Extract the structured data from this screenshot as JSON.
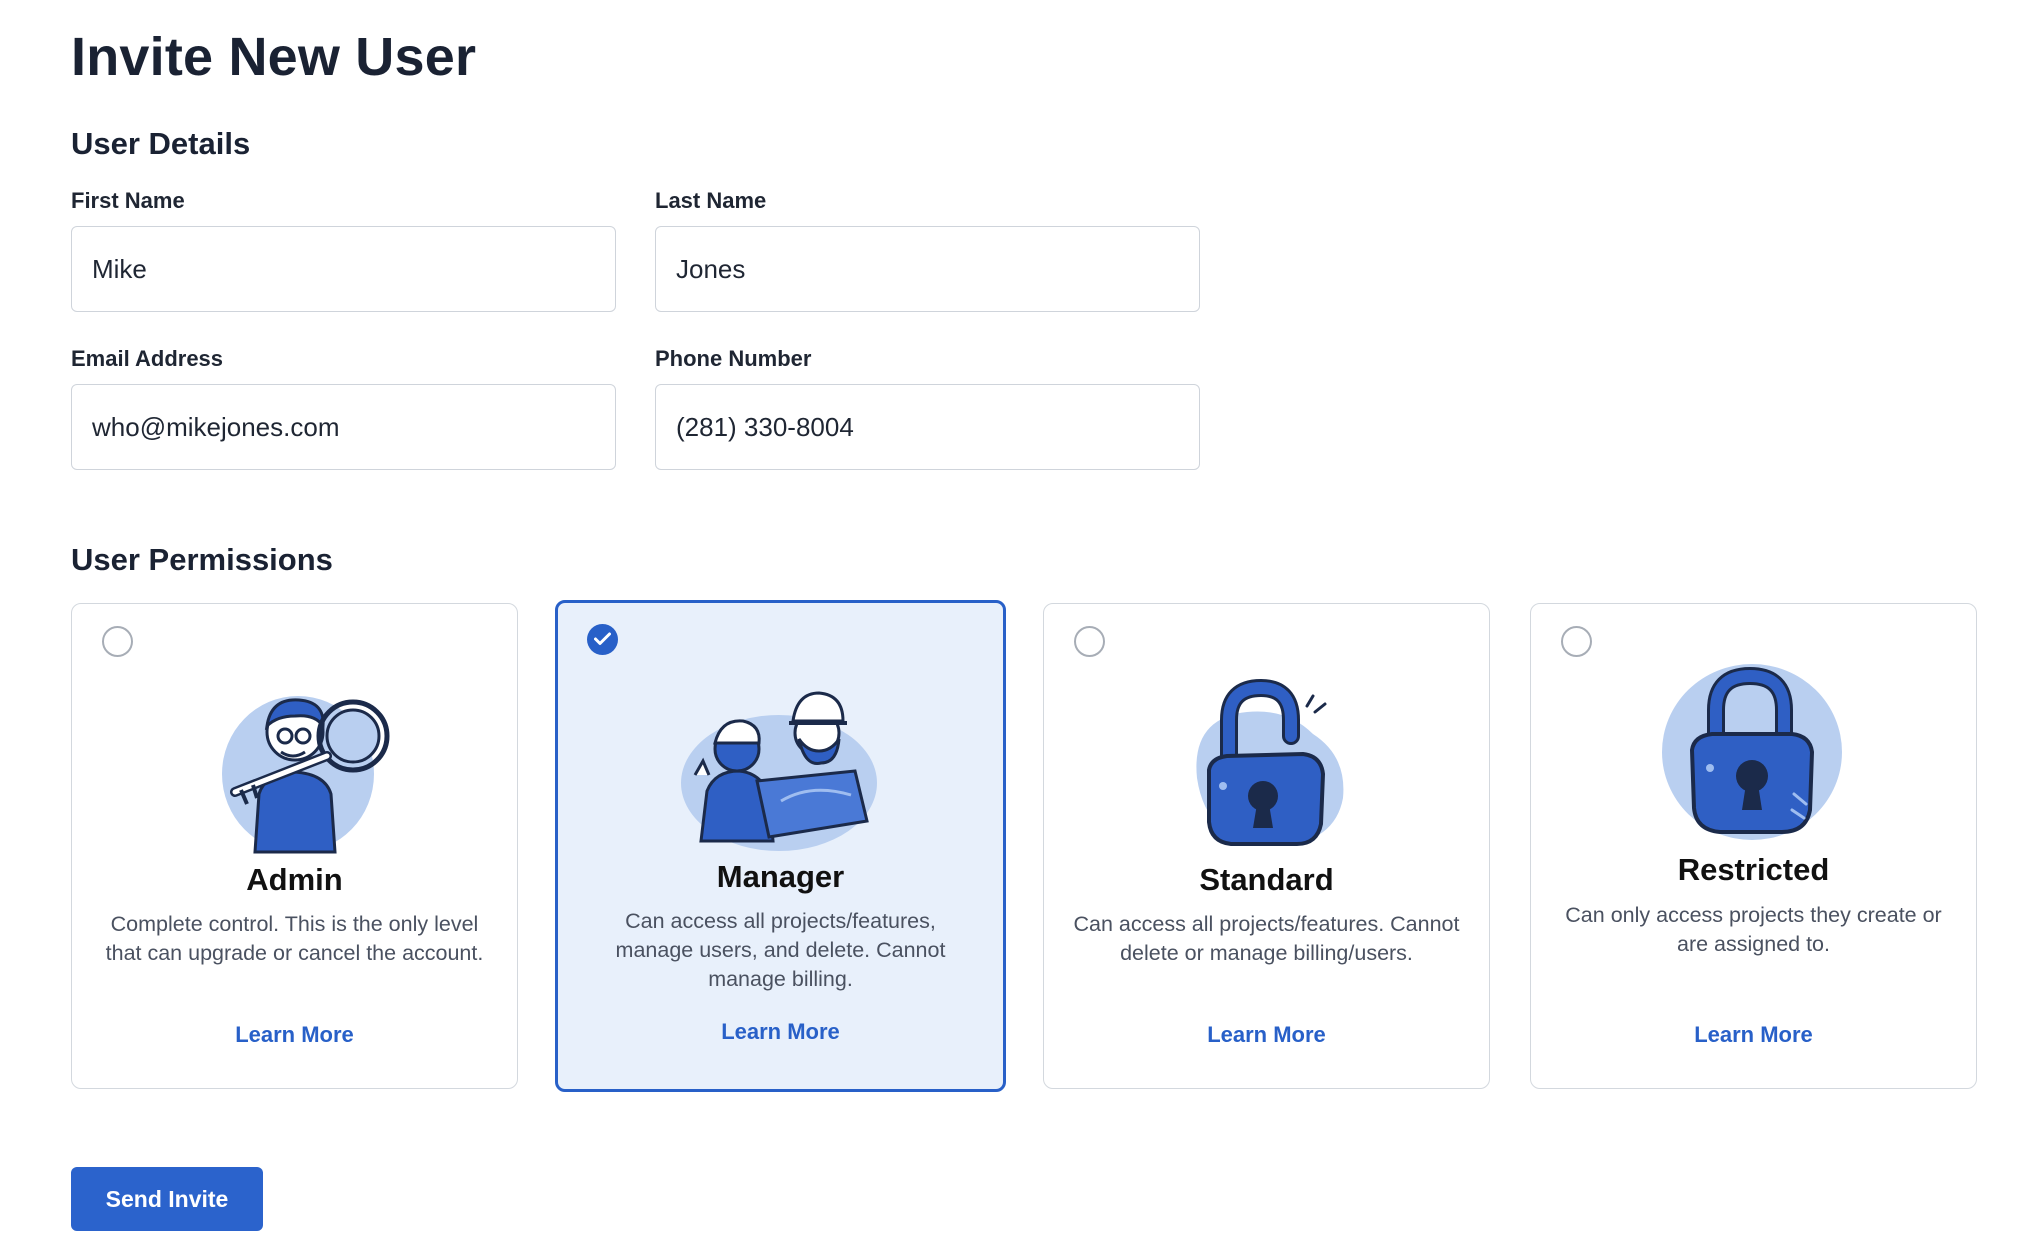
{
  "page": {
    "title": "Invite New User"
  },
  "user_details": {
    "heading": "User Details",
    "first_name": {
      "label": "First Name",
      "value": "Mike"
    },
    "last_name": {
      "label": "Last Name",
      "value": "Jones"
    },
    "email": {
      "label": "Email Address",
      "value": "who@mikejones.com"
    },
    "phone": {
      "label": "Phone Number",
      "value": "(281) 330-8004"
    }
  },
  "permissions": {
    "heading": "User Permissions",
    "selected": "Manager",
    "options": [
      {
        "name": "Admin",
        "description": "Complete control. This is the only level that can upgrade or cancel the account.",
        "link": "Learn More",
        "illustration": "person-with-key-illustration"
      },
      {
        "name": "Manager",
        "description": "Can access all projects/features, manage users, and delete. Cannot manage billing.",
        "link": "Learn More",
        "illustration": "workers-with-blueprint-illustration"
      },
      {
        "name": "Standard",
        "description": "Can access all projects/features. Cannot delete or manage billing/users.",
        "link": "Learn More",
        "illustration": "open-padlock-illustration"
      },
      {
        "name": "Restricted",
        "description": "Can only access projects they create or are assigned to.",
        "link": "Learn More",
        "illustration": "closed-padlock-illustration"
      }
    ]
  },
  "actions": {
    "send_label": "Send Invite"
  },
  "colors": {
    "accent": "#2860c8",
    "selected_bg": "#e8f0fb",
    "illustration_light": "#b9cff0",
    "illustration_dark": "#2f5fc4"
  }
}
